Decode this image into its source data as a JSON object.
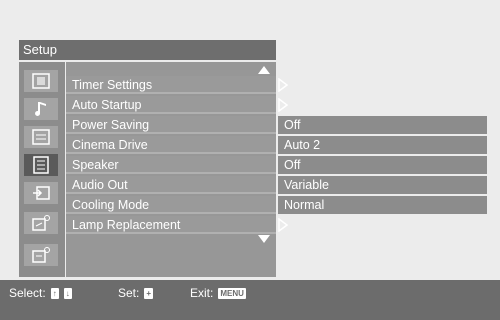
{
  "setup": {
    "title": "Setup"
  },
  "menu": {
    "items": [
      {
        "label": "Timer Settings",
        "value": null
      },
      {
        "label": "Auto Startup",
        "value": null
      },
      {
        "label": "Power Saving",
        "value": "Off"
      },
      {
        "label": "Cinema Drive",
        "value": "Auto 2"
      },
      {
        "label": "Speaker",
        "value": "Off"
      },
      {
        "label": "Audio Out",
        "value": "Variable"
      },
      {
        "label": "Cooling Mode",
        "value": "Normal"
      },
      {
        "label": "Lamp Replacement",
        "value": null
      }
    ]
  },
  "sidebar": {
    "icons": [
      "picture-icon",
      "sound-icon",
      "screen-icon",
      "setup-icon",
      "input-icon",
      "installation-icon",
      "info-icon"
    ],
    "selected_index": 3
  },
  "footer": {
    "select_label": "Select:",
    "select_keys": [
      "↑",
      "↓"
    ],
    "set_label": "Set:",
    "set_key": "+",
    "exit_label": "Exit:",
    "exit_key": "MENU"
  },
  "colors": {
    "background": "#ececec",
    "title_bar": "#6e6e6e",
    "icon_column": "#8c8c8c",
    "menu_panel": "#979797",
    "value_cell": "#8c8c8c",
    "bottom_bar": "#6c6c6c",
    "text": "#ffffff"
  }
}
